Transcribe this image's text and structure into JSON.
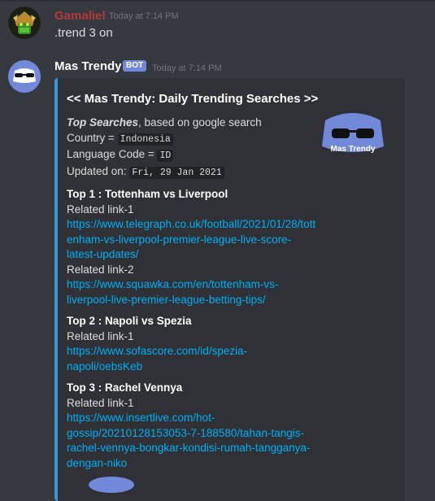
{
  "messages": [
    {
      "username": "Gamaliel",
      "timestamp": "Today at 7:14 PM",
      "text": ".trend 3 on"
    },
    {
      "username": "Mas Trendy",
      "bot_badge": "BOT",
      "timestamp": "Today at 7:14 PM",
      "avatar_text": "Mas Trendy",
      "embed": {
        "title": "<< Mas Trendy: Daily Trending Searches >>",
        "thumbnail_text": "Mas Trendy",
        "top_searches_label": "Top Searches",
        "top_searches_suffix": ", based on google search",
        "country_label": "Country = ",
        "country_value": "Indonesia",
        "language_label": "Language Code = ",
        "language_value": "ID",
        "updated_label": "Updated on: ",
        "updated_value": "Fri, 29 Jan 2021",
        "fields": [
          {
            "name": "Top 1 : Tottenham vs Liverpool",
            "links": [
              {
                "label": "Related link-1",
                "url": "https://www.telegraph.co.uk/football/2021/01/28/tottenham-vs-liverpool-premier-league-live-score-latest-updates/"
              },
              {
                "label": "Related link-2",
                "url": "https://www.squawka.com/en/tottenham-vs-liverpool-live-premier-league-betting-tips/"
              }
            ]
          },
          {
            "name": "Top 2 : Napoli vs Spezia",
            "links": [
              {
                "label": "Related link-1",
                "url": "https://www.sofascore.com/id/spezia-napoli/oebsKeb"
              }
            ]
          },
          {
            "name": "Top 3 : Rachel Vennya",
            "links": [
              {
                "label": "Related link-1",
                "url": "https://www.insertlive.com/hot-gossip/20210128153053-7-188580/tahan-tangis-rachel-vennya-bongkar-kondisi-rumah-tangganya-dengan-niko"
              }
            ]
          }
        ]
      }
    }
  ],
  "colors": {
    "background": "#36393f",
    "embed_bg": "#2f3136",
    "embed_accent": "#3498db",
    "link": "#00b0f4",
    "username_1": "#b33a3a",
    "username_2": "#ffffff",
    "bot_badge": "#7289da"
  },
  "icons": [
    "gamer-avatar-icon",
    "mas-trendy-avatar-icon",
    "mas-trendy-thumbnail-icon"
  ]
}
